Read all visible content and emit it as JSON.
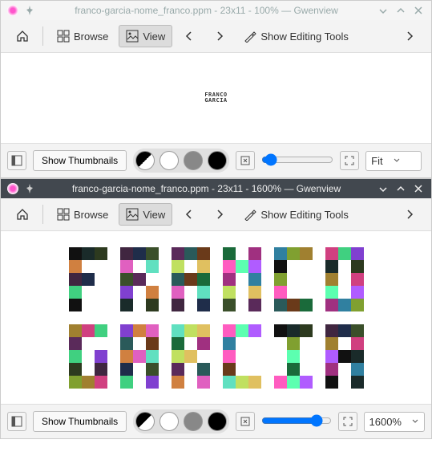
{
  "window1": {
    "title": "franco-garcia-nome_franco.ppm - 23x11 - 100% — Gwenview",
    "toolbar": {
      "browse_label": "Browse",
      "view_label": "View",
      "editing_label": "Show Editing Tools"
    },
    "small_text_line1": "FRANCO",
    "small_text_line2": "GARCIA",
    "bottombar": {
      "thumbnails_label": "Show Thumbnails",
      "zoom_label": "Fit"
    }
  },
  "window2": {
    "title": "franco-garcia-nome_franco.ppm - 23x11 - 1600% — Gwenview",
    "toolbar": {
      "browse_label": "Browse",
      "view_label": "View",
      "editing_label": "Show Editing Tools"
    },
    "bottombar": {
      "thumbnails_label": "Show Thumbnails",
      "zoom_label": "1600%"
    }
  }
}
